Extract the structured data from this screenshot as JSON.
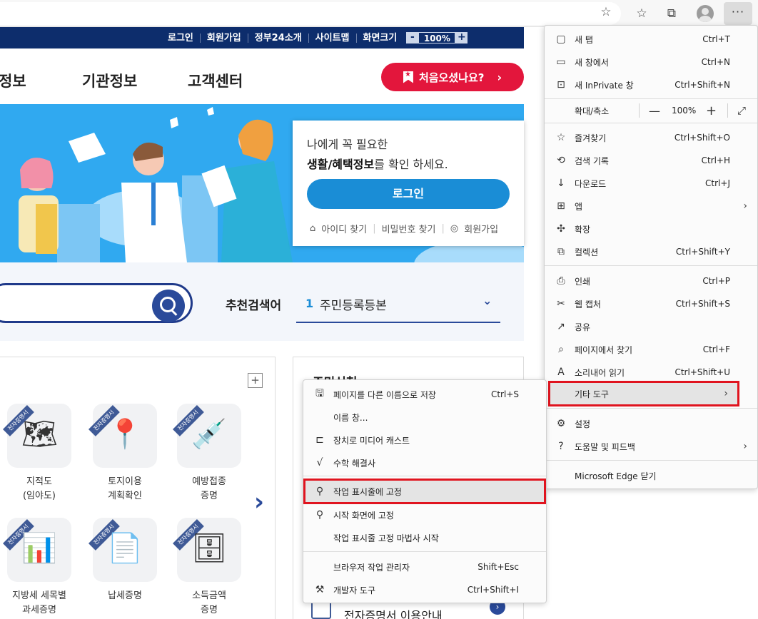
{
  "site": {
    "top_links": [
      "로그인",
      "회원가입",
      "정부24소개",
      "사이트맵"
    ],
    "zoom_label": "화면크기",
    "zoom_minus": "-",
    "zoom_value": "100%",
    "zoom_plus": "+",
    "nav": [
      "정보",
      "기관정보",
      "고객센터"
    ],
    "first_visit": "처음오셨나요?",
    "first_visit_chevron": "›",
    "login_card": {
      "line1": "나에게 꼭 필요한",
      "line2_bold": "생활/혜택정보",
      "line2_rest": "를 확인 하세요.",
      "button": "로그인",
      "find_id": "아이디 찾기",
      "find_pw": "비밀번호 찾기",
      "join": "회원가입"
    },
    "search": {
      "rec_label": "추천검색어",
      "rec_num": "1",
      "rec_term": "주민등록등본"
    },
    "panel_plus": "+",
    "ribbon": "전자증명서",
    "services": [
      {
        "l1": "지적도",
        "l2": "(임야도)",
        "glyph": "🗺"
      },
      {
        "l1": "토지이용",
        "l2": "계획확인",
        "glyph": "📍"
      },
      {
        "l1": "예방접종",
        "l2": "증명",
        "glyph": "💉"
      },
      {
        "l1": "지방세 세목별",
        "l2": "과세증명",
        "glyph": "📊"
      },
      {
        "l1": "납세증명",
        "l2": "",
        "glyph": "📄"
      },
      {
        "l1": "소득금액",
        "l2": "증명",
        "glyph": "🗄"
      }
    ],
    "panel_arrow": "›",
    "right_panel_title": "주민신청",
    "right_panel_bottom": "전자증명서 이용안내"
  },
  "browser": {
    "favorite_star": "☆",
    "more": "···"
  },
  "menu": {
    "items": [
      {
        "icon": "▢",
        "label": "새 탭",
        "shortcut": "Ctrl+T"
      },
      {
        "icon": "▭",
        "label": "새 창에서",
        "shortcut": "Ctrl+N"
      },
      {
        "icon": "⊡",
        "label": "새 InPrivate 창",
        "shortcut": "Ctrl+Shift+N"
      },
      {
        "icon": "",
        "label": "확대/축소",
        "shortcut": ""
      },
      {
        "icon": "☆",
        "label": "즐겨찾기",
        "shortcut": "Ctrl+Shift+O"
      },
      {
        "icon": "⟲",
        "label": "검색 기록",
        "shortcut": "Ctrl+H"
      },
      {
        "icon": "↓",
        "label": "다운로드",
        "shortcut": "Ctrl+J"
      },
      {
        "icon": "⊞",
        "label": "앱",
        "shortcut": ""
      },
      {
        "icon": "✣",
        "label": "확장",
        "shortcut": ""
      },
      {
        "icon": "⧉",
        "label": "컬렉션",
        "shortcut": "Ctrl+Shift+Y"
      },
      {
        "icon": "⎙",
        "label": "인쇄",
        "shortcut": "Ctrl+P"
      },
      {
        "icon": "✂",
        "label": "웹 캡처",
        "shortcut": "Ctrl+Shift+S"
      },
      {
        "icon": "↗",
        "label": "공유",
        "shortcut": ""
      },
      {
        "icon": "⌕",
        "label": "페이지에서 찾기",
        "shortcut": "Ctrl+F"
      },
      {
        "icon": "A",
        "label": "소리내어 읽기",
        "shortcut": "Ctrl+Shift+U"
      },
      {
        "icon": "",
        "label": "기타 도구",
        "shortcut": ""
      },
      {
        "icon": "⚙",
        "label": "설정",
        "shortcut": ""
      },
      {
        "icon": "?",
        "label": "도움말 및 피드백",
        "shortcut": ""
      },
      {
        "icon": "",
        "label": "Microsoft Edge 닫기",
        "shortcut": ""
      }
    ],
    "zoom_minus": "—",
    "zoom_value": "100%",
    "zoom_plus": "+",
    "zoom_full": "⤢",
    "arrow": "›"
  },
  "submenu": {
    "items": [
      {
        "icon": "🖫",
        "label": "페이지를 다른 이름으로 저장",
        "shortcut": "Ctrl+S"
      },
      {
        "icon": "",
        "label": "이름 창...",
        "shortcut": ""
      },
      {
        "icon": "⊏",
        "label": "장치로 미디어 캐스트",
        "shortcut": ""
      },
      {
        "icon": "√",
        "label": "수학 해결사",
        "shortcut": ""
      },
      {
        "icon": "⚲",
        "label": "작업 표시줄에 고정",
        "shortcut": ""
      },
      {
        "icon": "⚲",
        "label": "시작 화면에 고정",
        "shortcut": ""
      },
      {
        "icon": "",
        "label": "작업 표시줄 고정 마법사 시작",
        "shortcut": ""
      },
      {
        "icon": "",
        "label": "브라우저 작업 관리자",
        "shortcut": "Shift+Esc"
      },
      {
        "icon": "⚒",
        "label": "개발자 도구",
        "shortcut": "Ctrl+Shift+I"
      }
    ]
  },
  "colors": {
    "highlight_outline": "#e0141f",
    "site_navy": "#0d2d6c",
    "brand_red": "#e3163c",
    "hero_blue": "#30a9f0"
  }
}
